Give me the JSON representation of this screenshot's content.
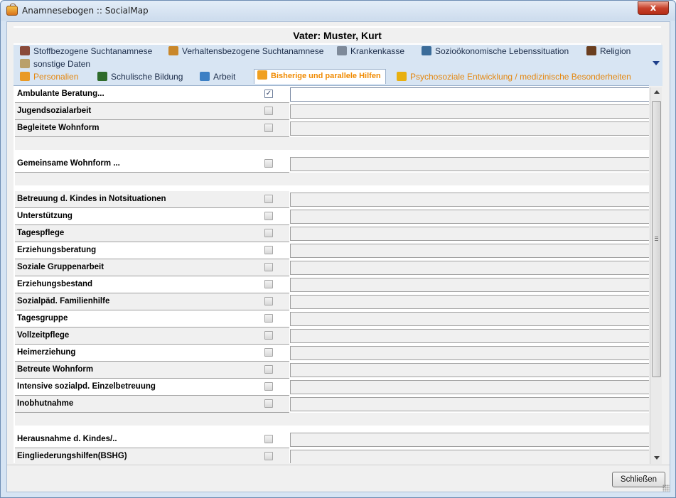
{
  "window": {
    "title": "Anamnesebogen :: SocialMap",
    "close_glyph": "x"
  },
  "heading": "Vater: Muster, Kurt",
  "tabs": [
    {
      "label": "Stoffbezogene Suchtanamnese",
      "icon": "addiction-icon",
      "color": "#8a4b3b"
    },
    {
      "label": "Verhaltensbezogene Suchtanamnese",
      "icon": "cart-icon",
      "color": "#c9872a"
    },
    {
      "label": "Krankenkasse",
      "icon": "health-icon",
      "color": "#7e8a9a"
    },
    {
      "label": "Sozioökonomische Lebenssituation",
      "icon": "people-icon",
      "color": "#3b6c99"
    },
    {
      "label": "Religion",
      "icon": "book-icon",
      "color": "#6a3e1f"
    },
    {
      "label": "sonstige Daten",
      "icon": "calendar-icon",
      "color": "#b9a06a"
    },
    {
      "label": "Personalien",
      "icon": "person-card-icon",
      "color": "#e99a26"
    },
    {
      "label": "Schulische Bildung",
      "icon": "blackboard-icon",
      "color": "#2e6b2a"
    },
    {
      "label": "Arbeit",
      "icon": "work-icon",
      "color": "#3c7fc4"
    },
    {
      "label": "Bisherige und parallele Hilfen",
      "icon": "lifebuoy-icon",
      "color": "#f0a020"
    },
    {
      "label": "Psychosoziale Entwicklung / medizinische Besonderheiten",
      "icon": "development-icon",
      "color": "#e8b010"
    }
  ],
  "rows": [
    {
      "label": "Ambulante Beratung...",
      "checked": true,
      "value": ""
    },
    {
      "label": "Jugendsozialarbeit",
      "checked": false,
      "value": ""
    },
    {
      "label": "Begleitete Wohnform",
      "checked": false,
      "value": ""
    },
    {
      "label": "Gemeinsame Wohnform ...",
      "checked": false,
      "value": ""
    },
    {
      "label": "Betreuung d. Kindes in Notsituationen",
      "checked": false,
      "value": ""
    },
    {
      "label": "Unterstützung",
      "checked": false,
      "value": ""
    },
    {
      "label": "Tagespflege",
      "checked": false,
      "value": ""
    },
    {
      "label": "Erziehungsberatung",
      "checked": false,
      "value": ""
    },
    {
      "label": "Soziale Gruppenarbeit",
      "checked": false,
      "value": ""
    },
    {
      "label": "Erziehungsbestand",
      "checked": false,
      "value": ""
    },
    {
      "label": "Sozialpäd. Familienhilfe",
      "checked": false,
      "value": ""
    },
    {
      "label": "Tagesgruppe",
      "checked": false,
      "value": ""
    },
    {
      "label": "Vollzeitpflege",
      "checked": false,
      "value": ""
    },
    {
      "label": "Heimerziehung",
      "checked": false,
      "value": ""
    },
    {
      "label": "Betreute Wohnform",
      "checked": false,
      "value": ""
    },
    {
      "label": "Intensive sozialpd. Einzelbetreuung",
      "checked": false,
      "value": ""
    },
    {
      "label": "Inobhutnahme",
      "checked": false,
      "value": ""
    },
    {
      "label": "Herausnahme d. Kindes/..",
      "checked": false,
      "value": ""
    },
    {
      "label": "Eingliederungshilfen(BSHG)",
      "checked": false,
      "value": ""
    }
  ],
  "footer": {
    "close_label": "Schließen"
  },
  "colors": {
    "accent": "#f08a00",
    "frame": "#d6e4f3",
    "close": "#c7412b"
  }
}
